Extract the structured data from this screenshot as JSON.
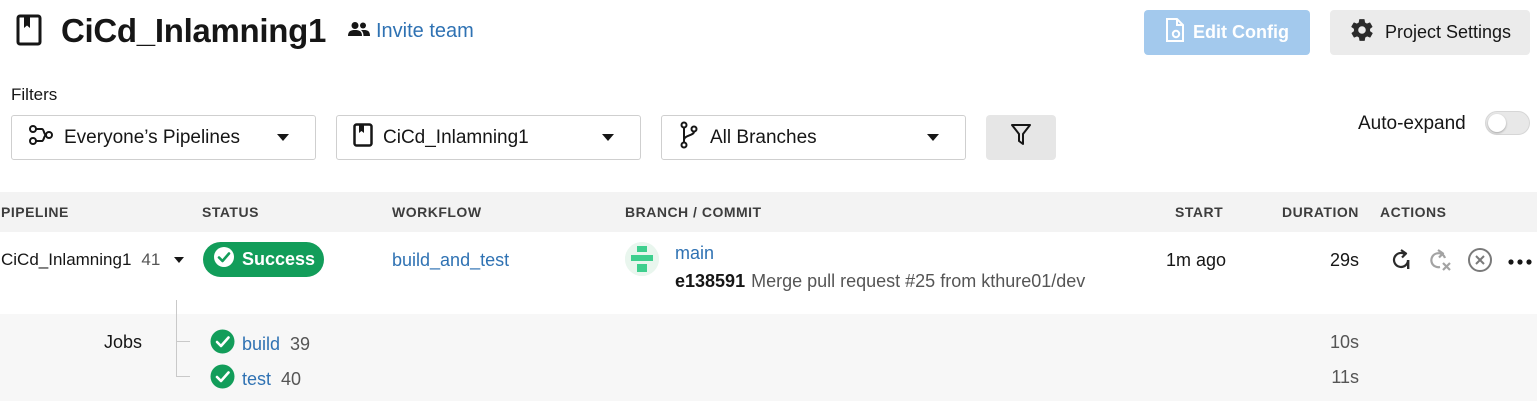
{
  "header": {
    "project_title": "CiCd_Inlamning1",
    "invite_label": "Invite team",
    "edit_config_label": "Edit Config",
    "project_settings_label": "Project Settings"
  },
  "filters": {
    "label": "Filters",
    "pipelines_select": "Everyone’s Pipelines",
    "project_select": "CiCd_Inlamning1",
    "branch_select": "All Branches",
    "auto_expand_label": "Auto-expand",
    "auto_expand_on": false
  },
  "table": {
    "columns": {
      "pipeline": "PIPELINE",
      "status": "STATUS",
      "workflow": "WORKFLOW",
      "branch_commit": "BRANCH / COMMIT",
      "start": "START",
      "duration": "DURATION",
      "actions": "ACTIONS"
    },
    "row": {
      "pipeline_name": "CiCd_Inlamning1",
      "pipeline_number": "41",
      "status": "Success",
      "workflow": "build_and_test",
      "branch": "main",
      "commit_hash": "e138591",
      "commit_message": "Merge pull request #25 from kthure01/dev",
      "start": "1m ago",
      "duration": "29s"
    },
    "jobs": {
      "label": "Jobs",
      "items": [
        {
          "name": "build",
          "number": "39",
          "duration": "10s"
        },
        {
          "name": "test",
          "number": "40",
          "duration": "11s"
        }
      ]
    }
  },
  "colors": {
    "accent_link": "#2f72b3",
    "success": "#129d5a",
    "edit_config_bg": "#a3c9ed"
  },
  "icons": [
    "project-book-icon",
    "people-icon",
    "file-gear-icon",
    "gear-icon",
    "pipelines-icon",
    "branch-icon",
    "funnel-icon",
    "check-icon",
    "rerun-icon",
    "rerun-failed-icon",
    "cancel-icon",
    "more-icon"
  ]
}
